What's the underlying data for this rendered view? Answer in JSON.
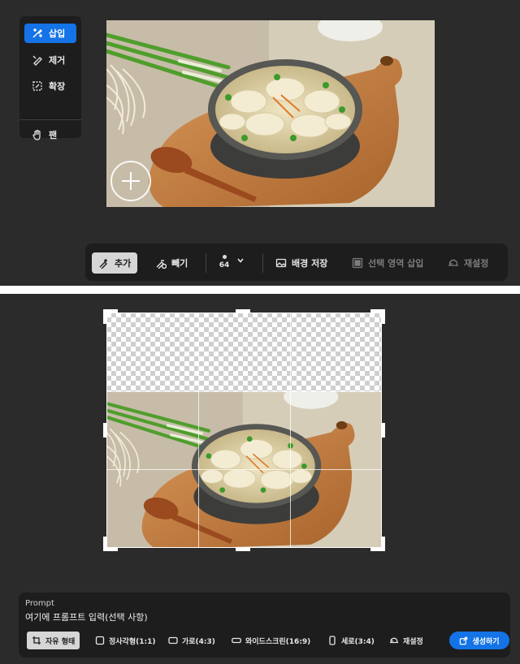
{
  "top_panel": {
    "tools": [
      {
        "label": "삽입",
        "icon": "insert-brush-icon",
        "active": true
      },
      {
        "label": "제거",
        "icon": "remove-brush-icon",
        "active": false
      },
      {
        "label": "확장",
        "icon": "expand-icon",
        "active": false
      },
      {
        "label": "팬",
        "icon": "hand-icon",
        "active": false
      }
    ],
    "toolbar": {
      "add_label": "추가",
      "subtract_label": "빼기",
      "brush_size": "64",
      "save_background_label": "배경 저장",
      "insert_selection_label": "선택 영역 삽입",
      "reset_label": "재설정"
    }
  },
  "bottom_panel": {
    "prompt": {
      "label": "Prompt",
      "placeholder": "여기에 프롬프트 입력(선택 사항)"
    },
    "aspect_options": [
      {
        "label": "자유 형태",
        "icon": "crop-icon",
        "selected": true
      },
      {
        "label": "정사각형(1:1)",
        "icon": "square-icon",
        "selected": false
      },
      {
        "label": "가로(4:3)",
        "icon": "landscape-icon",
        "selected": false
      },
      {
        "label": "와이드스크린(16:9)",
        "icon": "widescreen-icon",
        "selected": false
      },
      {
        "label": "세로(3:4)",
        "icon": "portrait-icon",
        "selected": false
      }
    ],
    "reset_label": "재설정",
    "generate_label": "생성하기"
  },
  "colors": {
    "accent": "#1473e6",
    "panel_bg": "#2b2b2b",
    "bar_bg": "#1d1d1d"
  }
}
